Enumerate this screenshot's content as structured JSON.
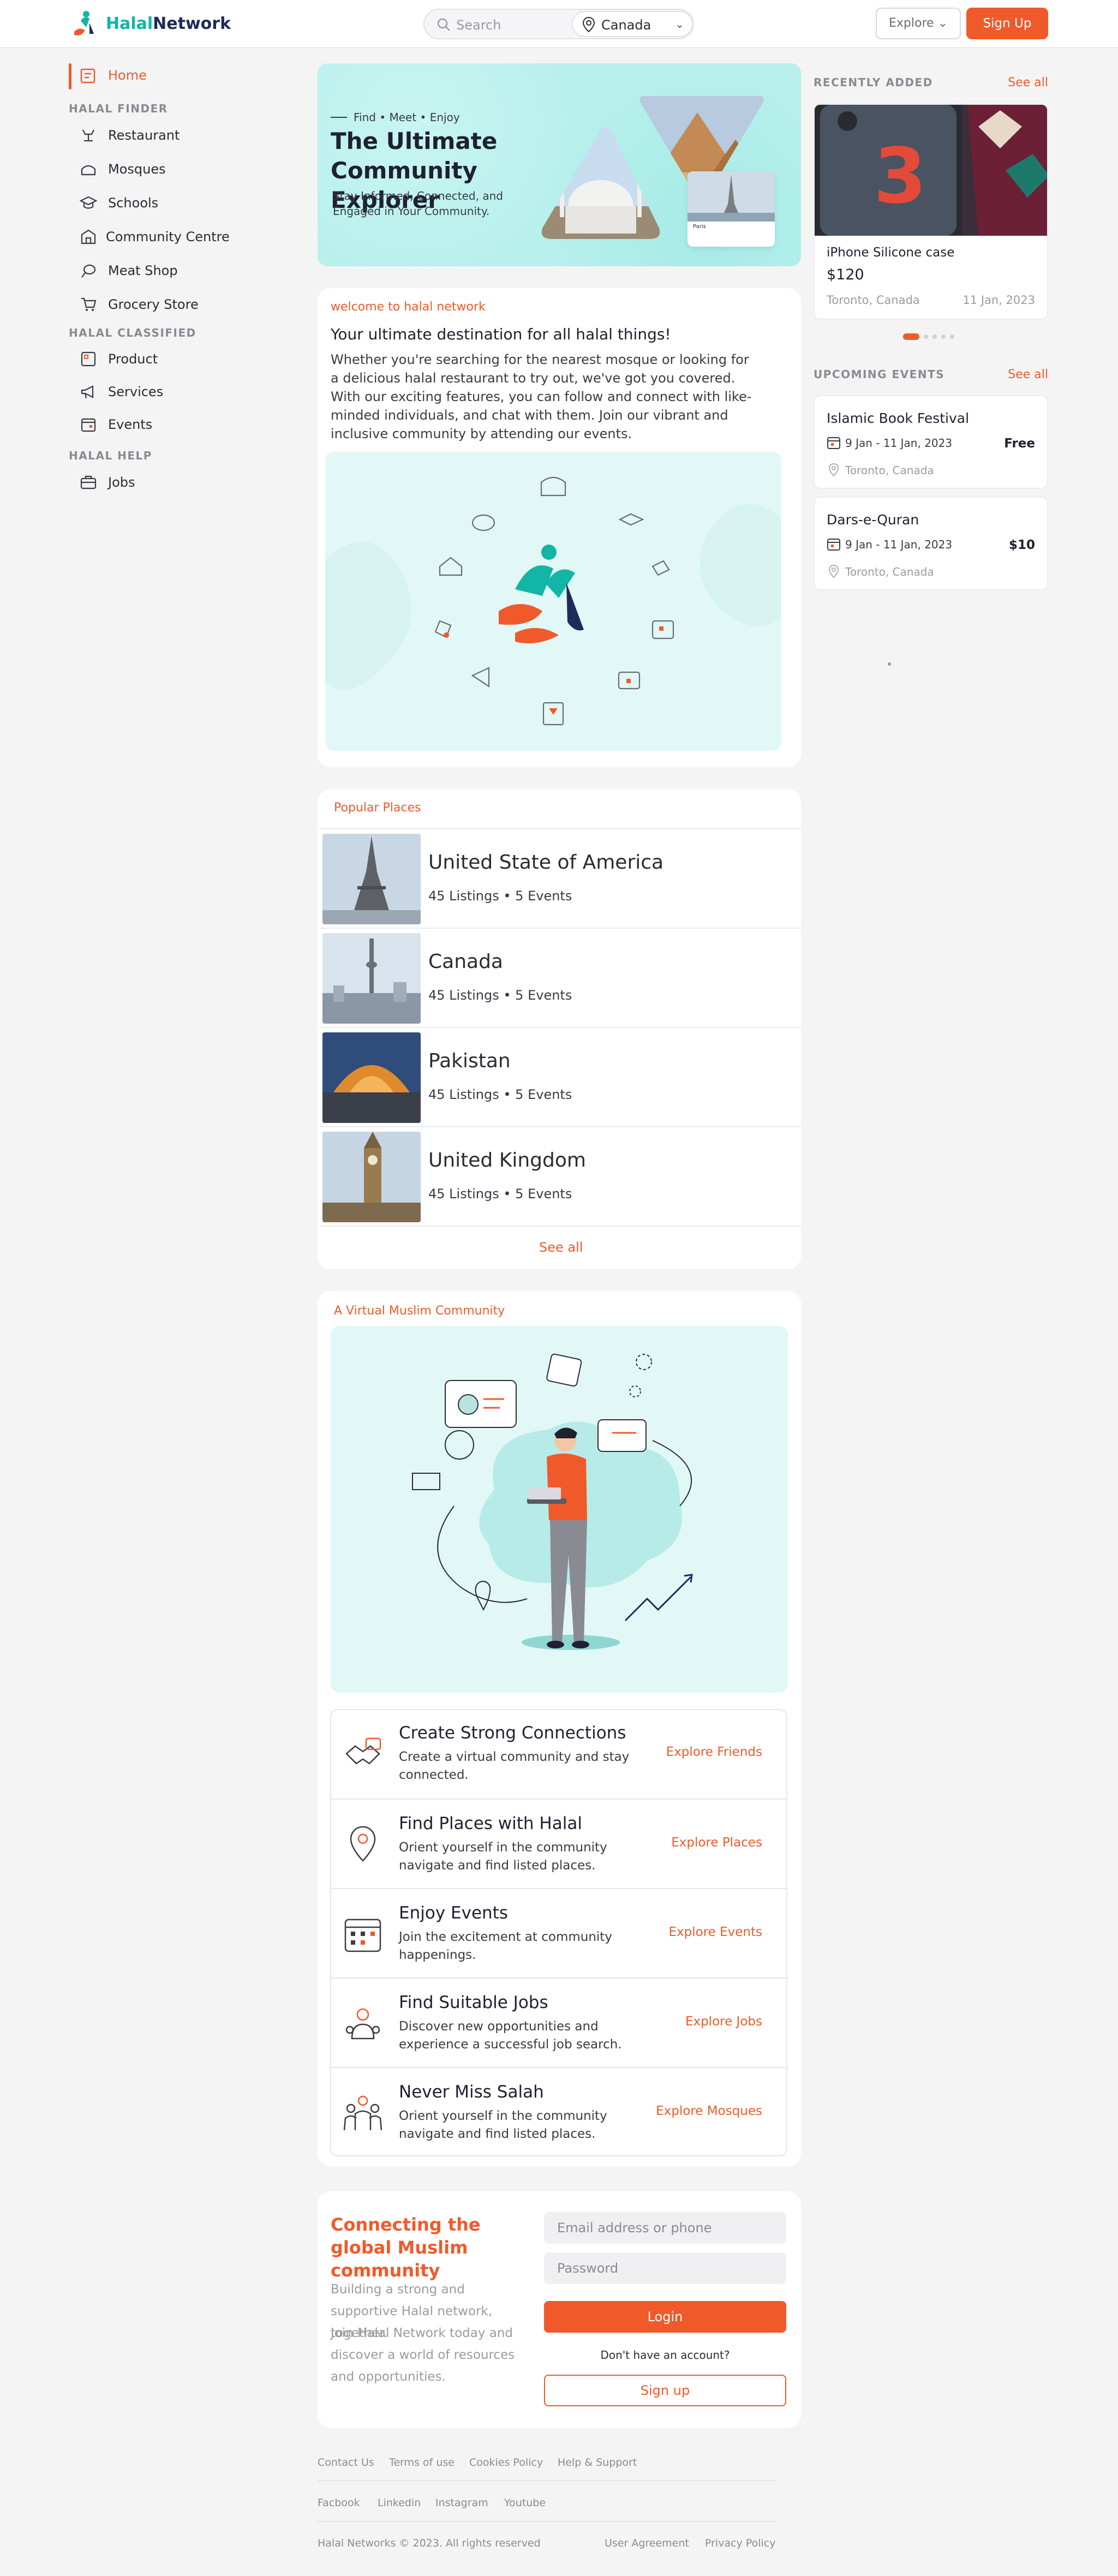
{
  "header": {
    "logo_halal": "Halal",
    "logo_network": "Network",
    "search_placeholder": "Search",
    "location": "Canada",
    "explore_label": "Explore",
    "signup_label": "Sign Up"
  },
  "sidebar": {
    "home": "Home",
    "sections": [
      {
        "heading": "HALAL FINDER",
        "items": [
          "Restaurant",
          "Mosques",
          "Schools",
          "Community Centre",
          "Meat Shop",
          "Grocery Store"
        ]
      },
      {
        "heading": "HALAL CLASSIFIED",
        "items": [
          "Product",
          "Services",
          "Events"
        ]
      },
      {
        "heading": "HALAL HELP",
        "items": [
          "Jobs"
        ]
      }
    ]
  },
  "hero": {
    "tagline": "Find • Meet • Enjoy",
    "title": "The Ultimate Community Explorer",
    "subtitle": "Stay Informed, Connected, and Engaged in Your Community.",
    "card_city": "Paris"
  },
  "welcome": {
    "label": "welcome to halal network",
    "heading": "Your ultimate destination for all halal things!",
    "body": "Whether you're searching for the nearest mosque or looking for a delicious halal restaurant to try out, we've got you covered. With our exciting features, you can follow and connect with like-minded individuals, and chat with them. Join our vibrant and inclusive community by attending our events."
  },
  "popular": {
    "label": "Popular Places",
    "see_all": "See all",
    "places": [
      {
        "name": "United State of America",
        "listings": "45 Listings",
        "events": "5 Events"
      },
      {
        "name": "Canada",
        "listings": "45 Listings",
        "events": "5 Events"
      },
      {
        "name": "Pakistan",
        "listings": "45 Listings",
        "events": "5 Events"
      },
      {
        "name": "United Kingdom",
        "listings": "45 Listings",
        "events": "5 Events"
      }
    ]
  },
  "community": {
    "label": "A Virtual Muslim Community",
    "features": [
      {
        "title": "Create Strong Connections",
        "desc": "Create a virtual community and stay connected.",
        "link": "Explore Friends",
        "icon": "handshake-icon"
      },
      {
        "title": "Find Places with Halal",
        "desc": "Orient yourself in the community navigate and find listed places.",
        "link": "Explore Places",
        "icon": "map-pin-icon"
      },
      {
        "title": "Enjoy Events",
        "desc": "Join the excitement at community happenings.",
        "link": "Explore Events",
        "icon": "calendar-icon"
      },
      {
        "title": "Find Suitable Jobs",
        "desc": "Discover new opportunities and experience a successful job search.",
        "link": "Explore Jobs",
        "icon": "job-seeker-icon"
      },
      {
        "title": "Never Miss Salah",
        "desc": "Orient yourself in the community navigate and find listed places.",
        "link": "Explore Mosques",
        "icon": "prayer-group-icon"
      }
    ]
  },
  "login": {
    "heading": "Connecting the global Muslim community",
    "blurb1": "Building a strong and supportive Halal network, together.",
    "blurb2": "Join Halal Network today and discover a world of resources and opportunities.",
    "email_placeholder": "Email address or phone",
    "password_placeholder": "Password",
    "login_label": "Login",
    "no_account": "Don't have an account?",
    "signup_label": "Sign up"
  },
  "footer": {
    "links1": [
      "Contact Us",
      "Terms of use",
      "Cookies Policy",
      "Help & Support"
    ],
    "links2": [
      "Facbook",
      "Linkedin",
      "Instagram",
      "Youtube"
    ],
    "copyright": "Halal Networks © 2023. All rights reserved",
    "user_agreement": "User Agreement",
    "privacy": "Privacy Policy"
  },
  "recently_added": {
    "heading": "RECENTLY ADDED",
    "see_all": "See all",
    "item": {
      "title": "iPhone Silicone case",
      "price": "$120",
      "location": "Toronto, Canada",
      "date": "11 Jan, 2023",
      "case_number": "3"
    }
  },
  "upcoming_events": {
    "heading": "UPCOMING EVENTS",
    "see_all": "See all",
    "events": [
      {
        "title": "Islamic Book Festival",
        "dates": "9 Jan - 11 Jan, 2023",
        "price": "Free",
        "location": "Toronto, Canada"
      },
      {
        "title": "Dars-e-Quran",
        "dates": "9 Jan - 11 Jan, 2023",
        "price": "$10",
        "location": "Toronto, Canada"
      }
    ]
  },
  "colors": {
    "accent": "#f05a2a",
    "teal": "#12b5a6",
    "mint": "#dff7f5",
    "navy": "#1d2b5c"
  }
}
